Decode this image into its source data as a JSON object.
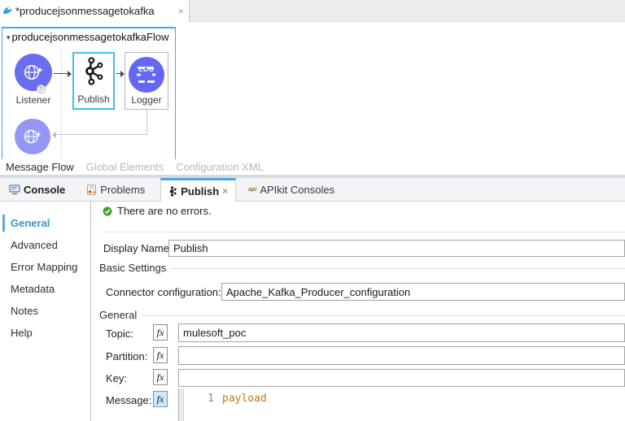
{
  "colors": {
    "accent_blue": "#4fa5e6",
    "selection_cyan": "#3fc1e8",
    "node_indigo": "#6b6df0",
    "node_indigo_light": "#9597f6",
    "sidebar_active_blue": "#2e96d4",
    "status_green": "#3fa12c",
    "code_keyword_orange": "#c0791c"
  },
  "editor_tab": {
    "title": "*producejsonmessagetokafka",
    "close_glyph": "×"
  },
  "flow": {
    "collapse_glyph": "▾",
    "title": "producejsonmessagetokafkaFlow",
    "listener_label": "Listener",
    "publish_label": "Publish",
    "logger_label": "Logger",
    "logger_icon_text": "LOG"
  },
  "canvas_tabs": {
    "message_flow": "Message Flow",
    "global_elements": "Global Elements",
    "configuration_xml": "Configuration XML"
  },
  "console_tabs": {
    "console": "Console",
    "problems": "Problems",
    "publish": "Publish",
    "publish_close_glyph": "×",
    "apikit": "APIkit Consoles",
    "apikit_icon_text": "api"
  },
  "properties": {
    "sidebar_items": [
      {
        "label": "General"
      },
      {
        "label": "Advanced"
      },
      {
        "label": "Error Mapping"
      },
      {
        "label": "Metadata"
      },
      {
        "label": "Notes"
      },
      {
        "label": "Help"
      }
    ],
    "status_message": "There are no errors.",
    "display_name": {
      "label": "Display Name:",
      "value": "Publish"
    },
    "basic_settings": {
      "title": "Basic Settings",
      "connector_label": "Connector configuration:",
      "connector_value": "Apache_Kafka_Producer_configuration"
    },
    "general": {
      "title": "General",
      "fx_glyph": "fx",
      "topic": {
        "label": "Topic:",
        "value": "mulesoft_poc"
      },
      "partition": {
        "label": "Partition:",
        "value": ""
      },
      "key": {
        "label": "Key:",
        "value": ""
      },
      "message": {
        "label": "Message:",
        "line_number": "1",
        "code": "payload"
      }
    }
  }
}
